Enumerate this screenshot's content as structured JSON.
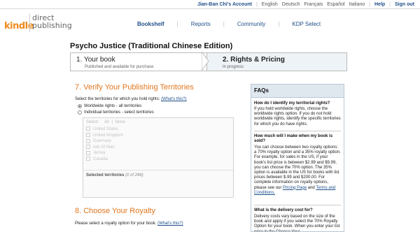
{
  "top": {
    "account": "Jian-Ban Chi's Account",
    "langs": [
      "English",
      "Deutsch",
      "Français",
      "Español",
      "Italiano"
    ],
    "help": "Help",
    "signout": "Sign out"
  },
  "logo": {
    "kindle": "kindle",
    "direct": "direct",
    "publishing": "publishing"
  },
  "nav": {
    "items": [
      "Bookshelf",
      "Reports",
      "Community",
      "KDP Select"
    ]
  },
  "book_title": "Psycho Justice (Traditional Chinese Edition)",
  "steps": {
    "s1_title": "1. Your book",
    "s1_sub": "Published and available for purchase",
    "s2_title": "2. Rights & Pricing",
    "s2_sub": "In progress"
  },
  "section7": {
    "title": "7. Verify Your Publishing Territories",
    "desc": "Select the territories for which you hold rights:",
    "help": "(What's this?)",
    "opt_worldwide": "Worldwide rights - all territories",
    "opt_individual": "Individual territories - select territories",
    "select_label": "Select:",
    "select_all": "All",
    "select_none": "None",
    "territories": [
      "United States",
      "United Kingdom",
      "Guernsey",
      "Isle Of Man",
      "Jersey",
      "Canada"
    ],
    "selected_label": "Selected territories",
    "selected_count": "(0 of 246)"
  },
  "section8": {
    "title": "8. Choose Your Royalty",
    "desc": "Please select a royalty option for your book.",
    "help": "(What's this?)"
  },
  "faq": {
    "title": "FAQs",
    "q1": "How do I identify my territorial rights?",
    "a1": "If you hold worldwide rights, choose the worldwide rights option. If you do not hold worldwide rights, identify the specific territories for which you do have rights.",
    "q2": "How much will I make when my book is sold?",
    "a2": "You can choose between two royalty options: a 70% royalty option and a 35% royalty option. For example, for sales in the US, if your book's list price is between $2.99 and $9.99, you can choose the 70% option. The 35% option is available in the US for books with list prices between $.99 and $200.00. For complete information on royalty options, please see our",
    "a2_link1": "Pricing Page",
    "a2_and": "and",
    "a2_link2": "Terms and Conditions.",
    "q3": "What is the delivery cost for?",
    "a3": "Delivery costs vary based on the size of the book and apply if you select the 70% Royalty Option for your book. When you enter your list price in the Choose Your"
  },
  "colors": {
    "accent": "#e2761e",
    "link": "#1f4f8a",
    "logo": "#f08a1d"
  }
}
